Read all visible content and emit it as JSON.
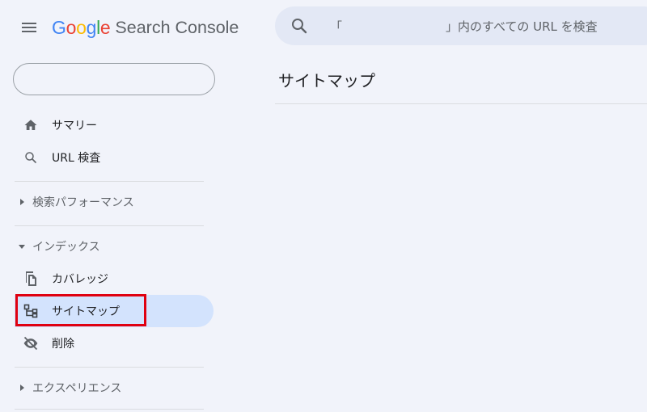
{
  "header": {
    "logo_letters": [
      {
        "char": "G",
        "color": "#4285F4"
      },
      {
        "char": "o",
        "color": "#EA4335"
      },
      {
        "char": "o",
        "color": "#FBBC05"
      },
      {
        "char": "g",
        "color": "#4285F4"
      },
      {
        "char": "l",
        "color": "#34A853"
      },
      {
        "char": "e",
        "color": "#EA4335"
      }
    ],
    "product_name": "Search Console",
    "menu_icon": "hamburger-menu-icon"
  },
  "search": {
    "icon": "search-icon",
    "bracket_open": "「",
    "text": "」内のすべての URL を検査"
  },
  "sidebar": {
    "property_value": "",
    "items": [
      {
        "label": "サマリー",
        "icon": "home-icon"
      },
      {
        "label": "URL 検査",
        "icon": "search-icon"
      },
      {
        "label": "カバレッジ",
        "icon": "coverage-icon"
      },
      {
        "label": "サイトマップ",
        "icon": "sitemap-icon"
      },
      {
        "label": "削除",
        "icon": "removals-icon"
      }
    ],
    "sections": [
      {
        "label": "検索パフォーマンス",
        "expanded": false
      },
      {
        "label": "インデックス",
        "expanded": true
      },
      {
        "label": "エクスペリエンス",
        "expanded": false
      }
    ]
  },
  "main": {
    "title": "サイトマップ"
  },
  "colors": {
    "background": "#f1f3fa",
    "search_bg": "#e3e8f5",
    "active_bg": "#d3e3fd",
    "highlight": "#e00010"
  }
}
